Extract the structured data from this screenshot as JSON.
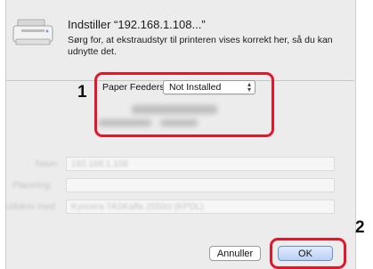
{
  "dialog": {
    "title": "Indstiller “192.168.1.108...”",
    "description": "Sørg for, at ekstraudstyr til printeren vises korrekt her, så du kan udnytte det."
  },
  "paper_feeders": {
    "label": "Paper Feeders:",
    "selected_value": "Not Installed"
  },
  "background_form": {
    "name_label": "Navn:",
    "name_value": "192.168.1.108",
    "location_label": "Placering:",
    "driver_label": "Udskriv med:",
    "driver_value": "Kyocera TASKalfa 2550ci (KPDL)"
  },
  "buttons": {
    "cancel_label": "Annuller",
    "ok_label": "OK"
  },
  "callouts": {
    "step_1": "1",
    "step_2": "2"
  },
  "colors": {
    "highlight": "#e4162a",
    "dialog_bg": "#ececec"
  },
  "icons": {
    "printer": "printer-icon"
  }
}
